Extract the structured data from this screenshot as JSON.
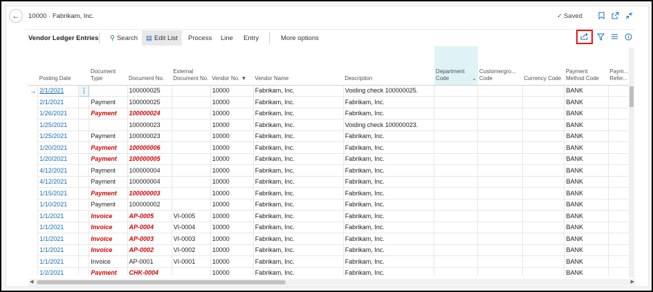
{
  "header": {
    "title": "10000 · Fabrikam, Inc.",
    "saved_label": "Saved"
  },
  "actionbar": {
    "caption": "Vendor Ledger Entries",
    "search": "Search",
    "edit_list": "Edit List",
    "process": "Process",
    "line": "Line",
    "entry": "Entry",
    "more": "More options"
  },
  "columns": [
    "Posting Date",
    "Document Type",
    "Document No.",
    "External Document No.",
    "Vendor No.",
    "Vendor Name",
    "Description",
    "Department Code",
    "Customergro... Code",
    "Currency Code",
    "Payment Method Code",
    "Paym... Refer..."
  ],
  "rows": [
    {
      "date": "2/1/2021",
      "type": "",
      "docno": "100000025",
      "ext": "",
      "vendor": "10000",
      "name": "Fabrikam, Inc.",
      "desc": "Voiding check 100000025.",
      "pay": "BANK",
      "red": false,
      "selected": true
    },
    {
      "date": "2/1/2021",
      "type": "Payment",
      "docno": "100000025",
      "ext": "",
      "vendor": "10000",
      "name": "Fabrikam, Inc.",
      "desc": "Fabrikam, Inc.",
      "pay": "BANK",
      "red": false
    },
    {
      "date": "1/26/2021",
      "type": "Payment",
      "docno": "100000024",
      "ext": "",
      "vendor": "10000",
      "name": "Fabrikam, Inc.",
      "desc": "Fabrikam, Inc.",
      "pay": "BANK",
      "red": true
    },
    {
      "date": "1/25/2021",
      "type": "",
      "docno": "100000023",
      "ext": "",
      "vendor": "10000",
      "name": "Fabrikam, Inc.",
      "desc": "Voiding check 100000023.",
      "pay": "BANK",
      "red": false
    },
    {
      "date": "1/25/2021",
      "type": "Payment",
      "docno": "100000023",
      "ext": "",
      "vendor": "10000",
      "name": "Fabrikam, Inc.",
      "desc": "Fabrikam, Inc.",
      "pay": "BANK",
      "red": false
    },
    {
      "date": "1/20/2021",
      "type": "Payment",
      "docno": "100000006",
      "ext": "",
      "vendor": "10000",
      "name": "Fabrikam, Inc.",
      "desc": "Fabrikam, Inc.",
      "pay": "BANK",
      "red": true
    },
    {
      "date": "1/20/2021",
      "type": "Payment",
      "docno": "100000005",
      "ext": "",
      "vendor": "10000",
      "name": "Fabrikam, Inc.",
      "desc": "Fabrikam, Inc.",
      "pay": "BANK",
      "red": true
    },
    {
      "date": "4/12/2021",
      "type": "Payment",
      "docno": "100000004",
      "ext": "",
      "vendor": "10000",
      "name": "Fabrikam, Inc.",
      "desc": "Fabrikam, Inc.",
      "pay": "BANK",
      "red": false
    },
    {
      "date": "4/12/2021",
      "type": "Payment",
      "docno": "100000004",
      "ext": "",
      "vendor": "10000",
      "name": "Fabrikam, Inc.",
      "desc": "Fabrikam, Inc.",
      "pay": "BANK",
      "red": false
    },
    {
      "date": "1/15/2021",
      "type": "Payment",
      "docno": "100000003",
      "ext": "",
      "vendor": "10000",
      "name": "Fabrikam, Inc.",
      "desc": "Fabrikam, Inc.",
      "pay": "BANK",
      "red": true
    },
    {
      "date": "1/10/2021",
      "type": "Payment",
      "docno": "100000002",
      "ext": "",
      "vendor": "10000",
      "name": "Fabrikam, Inc.",
      "desc": "Fabrikam, Inc.",
      "pay": "BANK",
      "red": false
    },
    {
      "date": "1/1/2021",
      "type": "Invoice",
      "docno": "AP-0005",
      "ext": "VI-0005",
      "vendor": "10000",
      "name": "Fabrikam, Inc.",
      "desc": "Fabrikam, Inc.",
      "pay": "BANK",
      "red": true
    },
    {
      "date": "1/1/2021",
      "type": "Invoice",
      "docno": "AP-0004",
      "ext": "VI-0004",
      "vendor": "10000",
      "name": "Fabrikam, Inc.",
      "desc": "Fabrikam, Inc.",
      "pay": "BANK",
      "red": true
    },
    {
      "date": "1/1/2021",
      "type": "Invoice",
      "docno": "AP-0003",
      "ext": "VI-0003",
      "vendor": "10000",
      "name": "Fabrikam, Inc.",
      "desc": "Fabrikam, Inc.",
      "pay": "BANK",
      "red": true
    },
    {
      "date": "1/1/2021",
      "type": "Invoice",
      "docno": "AP-0002",
      "ext": "VI-0002",
      "vendor": "10000",
      "name": "Fabrikam, Inc.",
      "desc": "Fabrikam, Inc.",
      "pay": "BANK",
      "red": true
    },
    {
      "date": "1/1/2021",
      "type": "Invoice",
      "docno": "AP-0001",
      "ext": "VI-0001",
      "vendor": "10000",
      "name": "Fabrikam, Inc.",
      "desc": "Fabrikam, Inc.",
      "pay": "BANK",
      "red": false
    },
    {
      "date": "1/2/2021",
      "type": "Payment",
      "docno": "CHK-0004",
      "ext": "",
      "vendor": "10000",
      "name": "Fabrikam, Inc.",
      "desc": "Fabrikam, Inc.",
      "pay": "BANK",
      "red": true
    }
  ],
  "icons": {
    "back": "back-arrow-icon",
    "saved": "check-icon",
    "bookmark": "bookmark-icon",
    "open_new": "open-new-window-icon",
    "collapse": "collapse-icon",
    "share": "share-icon",
    "filter": "filter-icon",
    "list": "list-view-icon",
    "info": "info-icon",
    "search": "search-icon",
    "edit_list": "edit-list-icon"
  },
  "colors": {
    "accent": "#0f6cbd",
    "negative": "#d50000",
    "highlight_border": "#e11111"
  }
}
